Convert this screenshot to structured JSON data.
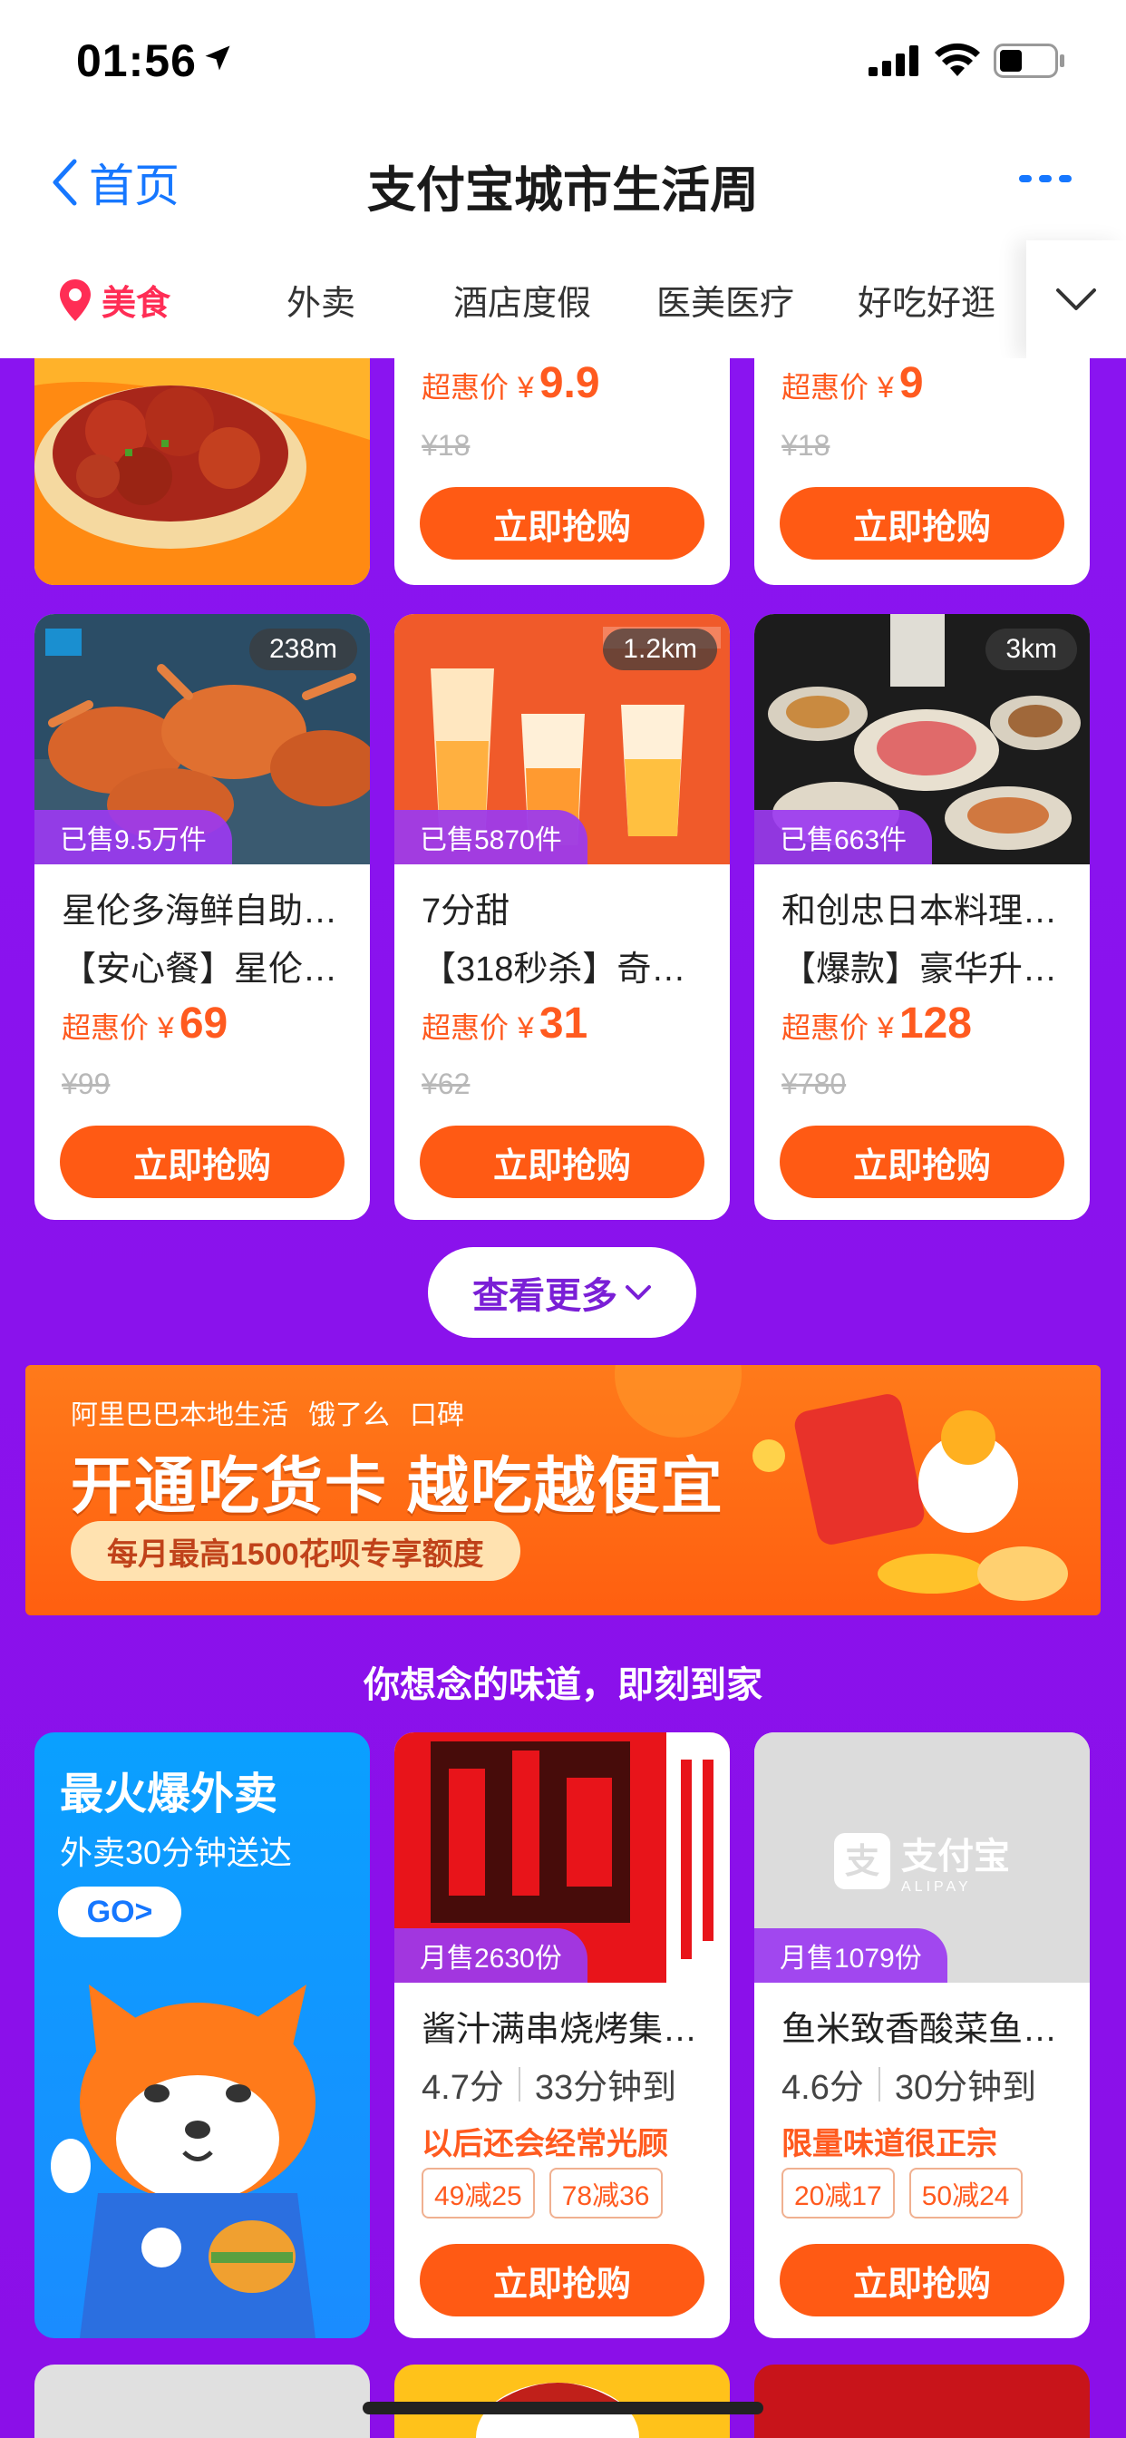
{
  "status": {
    "time": "01:56"
  },
  "nav": {
    "back_label": "首页",
    "title": "支付宝城市生活周"
  },
  "categories": [
    {
      "label": "美食"
    },
    {
      "label": "外卖"
    },
    {
      "label": "酒店度假"
    },
    {
      "label": "医美医疗"
    },
    {
      "label": "好吃好逛"
    }
  ],
  "top_row": [
    {
      "price_label": "超惠价",
      "currency": "¥",
      "price": "9.9",
      "original": "¥18",
      "buy": "立即抢购"
    },
    {
      "price_label": "超惠价",
      "currency": "¥",
      "price": "9",
      "original": "¥18",
      "buy": "立即抢购"
    }
  ],
  "deals": [
    {
      "distance": "238m",
      "sold": "已售9.5万件",
      "name": "星伦多海鲜自助…",
      "desc": "【安心餐】星伦…",
      "price_label": "超惠价",
      "currency": "¥",
      "price": "69",
      "original": "¥99",
      "buy": "立即抢购"
    },
    {
      "distance": "1.2km",
      "sold": "已售5870件",
      "name": "7分甜",
      "desc": "【318秒杀】奇…",
      "price_label": "超惠价",
      "currency": "¥",
      "price": "31",
      "original": "¥62",
      "buy": "立即抢购"
    },
    {
      "distance": "3km",
      "sold": "已售663件",
      "name": "和创忠日本料理…",
      "desc": "【爆款】豪华升…",
      "price_label": "超惠价",
      "currency": "¥",
      "price": "128",
      "original": "¥780",
      "buy": "立即抢购"
    }
  ],
  "more_label": "查看更多",
  "banner": {
    "logos": [
      "阿里巴巴本地生活",
      "饿了么",
      "口碑"
    ],
    "headline": "开通吃货卡 越吃越便宜",
    "pill": "每月最高1500花呗专享额度"
  },
  "section_title": "你想念的味道，即刻到家",
  "ad": {
    "title": "最火爆外卖",
    "subtitle": "外卖30分钟送达",
    "go": "GO>"
  },
  "takeout": [
    {
      "sold": "月售2630份",
      "name": "酱汁满串烧烤集…",
      "rating": "4.7分",
      "time": "33分钟到",
      "slogan": "以后还会经常光顾",
      "coupons": [
        "49减25",
        "78减36"
      ],
      "buy": "立即抢购"
    },
    {
      "sold": "月售1079份",
      "name": "鱼米致香酸菜鱼…",
      "rating": "4.6分",
      "time": "30分钟到",
      "slogan": "限量味道很正宗",
      "coupons": [
        "20减17",
        "50减24"
      ],
      "buy": "立即抢购",
      "placeholder_logo": "支付宝",
      "placeholder_sub": "ALIPAY"
    }
  ],
  "colors": {
    "accent": "#ff5a14",
    "brand_blue": "#1677ff",
    "purple": "#8a14f0",
    "tab_active": "#ff2d55"
  }
}
